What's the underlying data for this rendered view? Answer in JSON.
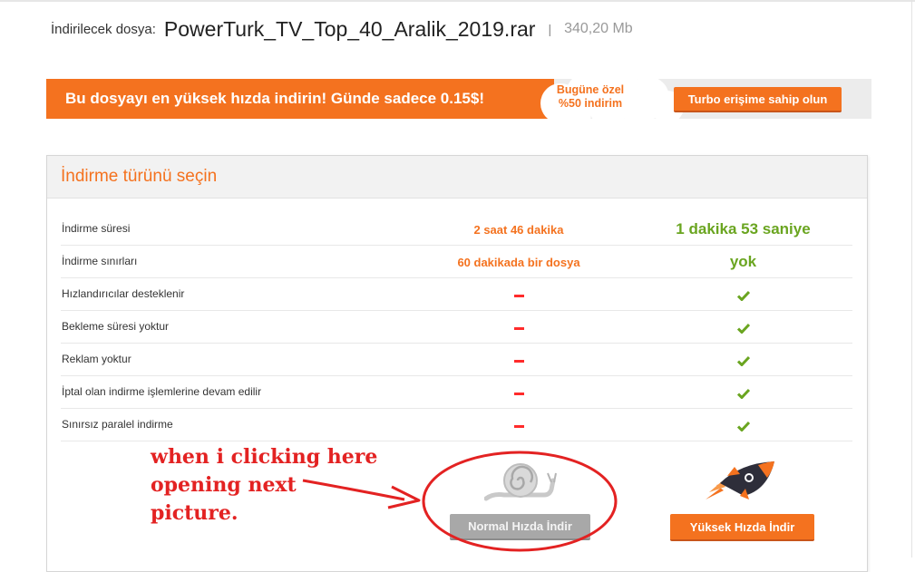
{
  "file": {
    "label": "İndirilecek dosya:",
    "name": "PowerTurk_TV_Top_40_Aralik_2019.rar",
    "separator": "|",
    "size": "340,20 Mb"
  },
  "promo": {
    "text": "Bu dosyayı en yüksek hızda indirin! Günde sadece 0.15$!",
    "cloud_line1": "Bugüne özel",
    "cloud_line2": "%50 indirim",
    "turbo_button": "Turbo erişime sahip olun"
  },
  "panel": {
    "title": "İndirme türünü seçin",
    "rows": [
      {
        "label": "İndirme süresi",
        "normal": "2 saat 46 dakika",
        "fast": "1 dakika 53 saniye"
      },
      {
        "label": "İndirme sınırları",
        "normal": "60 dakikada bir dosya",
        "fast": "yok"
      },
      {
        "label": "Hızlandırıcılar desteklenir",
        "normal": "dash-icon",
        "fast": "check-icon"
      },
      {
        "label": "Bekleme süresi yoktur",
        "normal": "dash-icon",
        "fast": "check-icon"
      },
      {
        "label": "Reklam yoktur",
        "normal": "dash-icon",
        "fast": "check-icon"
      },
      {
        "label": "İptal olan indirme işlemlerine devam edilir",
        "normal": "dash-icon",
        "fast": "check-icon"
      },
      {
        "label": "Sınırsız paralel indirme",
        "normal": "dash-icon",
        "fast": "check-icon"
      }
    ],
    "normal_button": "Normal Hızda İndir",
    "fast_button": "Yüksek Hızda İndir"
  },
  "annotation": {
    "line1": "when i clicking here",
    "line2": "opening next",
    "line3": "picture."
  },
  "colors": {
    "accent_orange": "#f4721f",
    "success_green": "#6aa520",
    "dash_red": "#ff2b2b",
    "annotation_red": "#e32222",
    "disabled_gray": "#a8a8a8"
  }
}
